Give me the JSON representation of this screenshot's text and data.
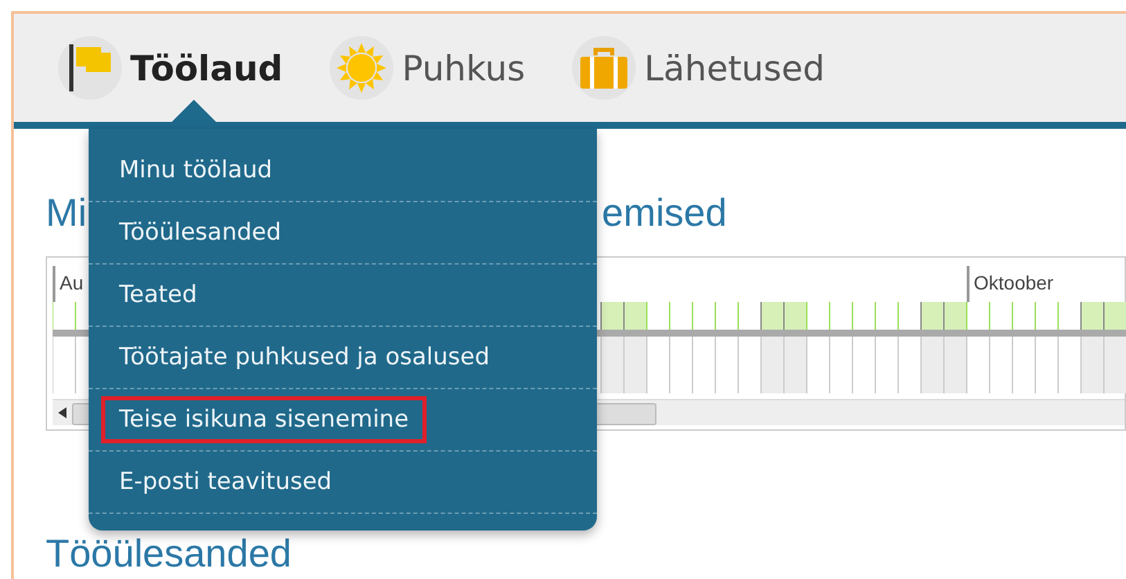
{
  "nav": [
    {
      "label": "Töölaud",
      "selected": true
    },
    {
      "label": "Puhkus",
      "selected": false
    },
    {
      "label": "Lähetused",
      "selected": false
    }
  ],
  "menu": [
    {
      "label": "Minu töölaud",
      "highlighted": false
    },
    {
      "label": "Tööülesanded",
      "highlighted": false
    },
    {
      "label": "Teated",
      "highlighted": false
    },
    {
      "label": "Töötajate puhkused ja osalused",
      "highlighted": false
    },
    {
      "label": "Teise isikuna sisenemine",
      "highlighted": true
    },
    {
      "label": "E-posti teavitused",
      "highlighted": false
    }
  ],
  "sections": [
    {
      "title_parts": [
        "Mi",
        "emised"
      ]
    },
    {
      "title": "Tööülesanded"
    }
  ],
  "timeline": {
    "months": [
      "Au",
      "Oktoober"
    ]
  }
}
